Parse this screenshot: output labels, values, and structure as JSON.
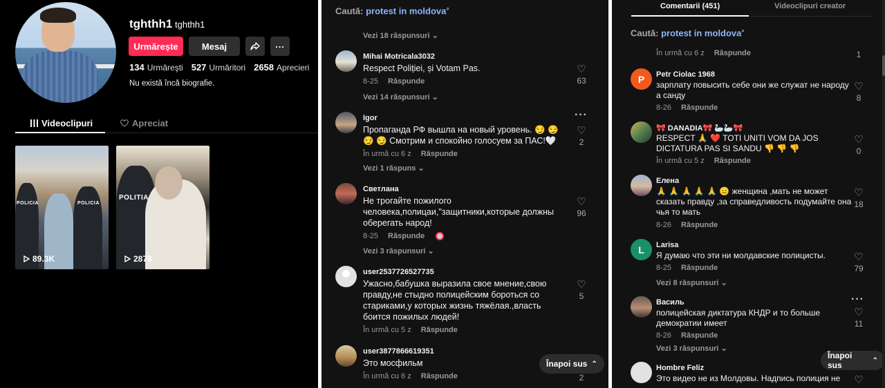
{
  "profile": {
    "username": "tghthh1",
    "nickname": "tghthh1",
    "follow_label": "Urmărește",
    "message_label": "Mesaj",
    "stats": [
      {
        "value": "134",
        "label": "Urmăreşti"
      },
      {
        "value": "527",
        "label": "Urmăritori"
      },
      {
        "value": "2658",
        "label": "Aprecieri"
      }
    ],
    "bio": "Nu există încă biografie.",
    "tab_videos": "Videoclipuri",
    "tab_liked": "Apreciat",
    "videos": [
      {
        "views": "89.3K",
        "badge1": "POLICIA",
        "badge2": "POLICIA"
      },
      {
        "views": "2878",
        "badge1": "POLITIA"
      }
    ]
  },
  "panel2": {
    "search_prefix": "Caută:",
    "search_query": "protest in moldova",
    "top_replies": "Vezi 18 răspunsuri",
    "reply_label": "Răspunde",
    "back_to_top": "Înapoi sus",
    "comments": [
      {
        "name": "Mihai Motricala3032",
        "text": "Respect Poliției, și Votam Pas.",
        "time": "8-25",
        "likes": "63",
        "replies": "Vezi 14 răspunsuri"
      },
      {
        "name": "Igor",
        "text": "Пропаганда РФ вышла на новый уровень. 😏 😏 😏 😏  Смотрим и спокойно голосуем за ПАС!🤍",
        "time": "În urmă cu 6 z",
        "likes": "2",
        "replies": "Vezi 1 răspuns"
      },
      {
        "name": "Светлана",
        "text": "Не трогайте пожилого человека,полицаи,\"защитники,которые должны оберегать народ!",
        "time": "8-25",
        "likes": "96",
        "replies": "Vezi 3 răspunsuri"
      },
      {
        "name": "user2537726527735",
        "text": "Ужасно,бабушка выразила свое мнение,свою правду,не стыдно полицейским бороться со стариками,у которых жизнь тяжёлая.,власть боится пожилых людей!",
        "time": "În urmă cu 5 z",
        "likes": "5"
      },
      {
        "name": "user3877866619351",
        "text": "Это мосфильм",
        "time": "În urmă cu 6 z",
        "likes": "2"
      }
    ]
  },
  "panel3": {
    "tab_comments": "Comentarii (451)",
    "tab_creator": "Videoclipuri creator",
    "search_prefix": "Caută:",
    "search_query": "protest in moldova",
    "reply_label": "Răspunde",
    "back_to_top": "Înapoi sus",
    "top_meta_time": "În urmă cu 6 z",
    "top_meta_likes": "1",
    "comments": [
      {
        "name": "Petr Ciolac 1968",
        "initial": "P",
        "color": "#f25a1c",
        "text": "зарплату повысить себе они же служат не народу а санду",
        "time": "8-26",
        "likes": "8"
      },
      {
        "name": "🎀 DANADIA🎀 🦢🦢🎀",
        "text": "RESPECT 🙏 ❤️ TOTI UNITI VOM DA JOS DICTATURA PAS SI SANDU 👎 👎 👎",
        "time": "În urmă cu 5 z",
        "likes": "0"
      },
      {
        "name": "Елена",
        "text": "🙏 🙏 🙏 🙏 🙏 😑 женщина ,мать не может сказать правду ,за справедливость подумайте она чья то мать",
        "time": "8-26",
        "likes": "18"
      },
      {
        "name": "Larisa",
        "initial": "L",
        "color": "#1a8f6a",
        "text": "Я думаю что эти ни молдавские полицисты.",
        "time": "8-25",
        "likes": "79",
        "replies": "Vezi 8 răspunsuri"
      },
      {
        "name": "Василь",
        "text": "полицейская диктатура КНДР и то больше демократии имеет",
        "time": "8-26",
        "likes": "11",
        "replies": "Vezi 3 răspunsuri"
      },
      {
        "name": "Hombre Feliz",
        "text": "Это видео не из Молдовы. Надпись полиция не",
        "time": "",
        "likes": ""
      }
    ]
  }
}
